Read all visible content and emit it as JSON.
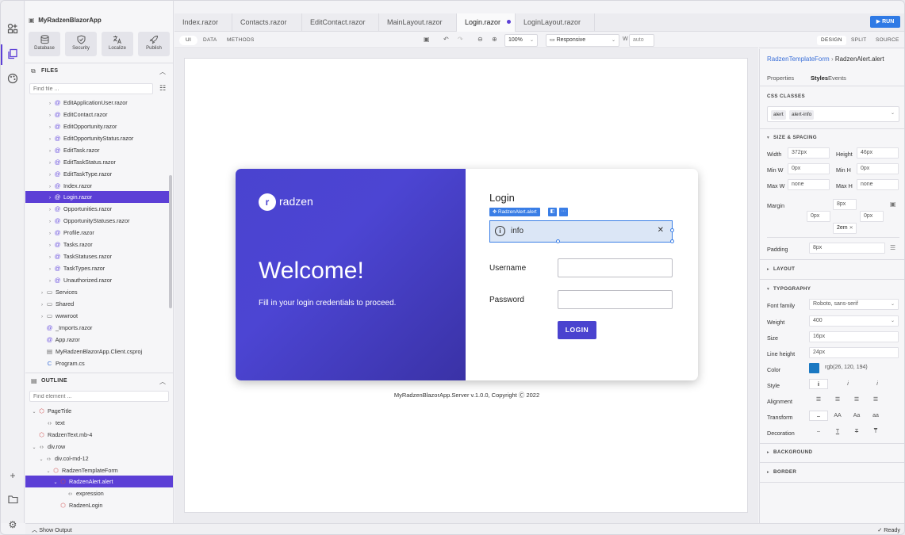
{
  "project": {
    "title": "MyRadzenBlazorApp"
  },
  "tools": [
    {
      "label": "Database",
      "icon": "database-icon"
    },
    {
      "label": "Security",
      "icon": "shield-icon"
    },
    {
      "label": "Localize",
      "icon": "translate-icon"
    },
    {
      "label": "Publish",
      "icon": "rocket-icon"
    }
  ],
  "files": {
    "header": "FILES",
    "search_placeholder": "Find file ...",
    "items": [
      "EditApplicationUser.razor",
      "EditContact.razor",
      "EditOpportunity.razor",
      "EditOpportunityStatus.razor",
      "EditTask.razor",
      "EditTaskStatus.razor",
      "EditTaskType.razor",
      "Index.razor",
      "Login.razor",
      "Opportunities.razor",
      "OpportunityStatuses.razor",
      "Profile.razor",
      "Tasks.razor",
      "TaskStatuses.razor",
      "TaskTypes.razor",
      "Unauthorized.razor"
    ],
    "folders": [
      "Services",
      "Shared",
      "wwwroot"
    ],
    "root_files": [
      "_Imports.razor",
      "App.razor",
      "MyRadzenBlazorApp.Client.csproj",
      "Program.cs"
    ]
  },
  "outline": {
    "header": "OUTLINE",
    "search_placeholder": "Find element ...",
    "items": [
      "PageTitle",
      "text",
      "RadzenText.mb-4",
      "div.row",
      "div.col-md-12",
      "RadzenTemplateForm",
      "RadzenAlert.alert",
      "expression",
      "RadzenLogin"
    ]
  },
  "tabs": [
    "Index.razor",
    "Contacts.razor",
    "EditContact.razor",
    "MainLayout.razor",
    "Login.razor",
    "LoginLayout.razor"
  ],
  "run_label": "RUN",
  "toolbar": {
    "modes": [
      "UI",
      "DATA",
      "METHODS"
    ],
    "zoom": "100%",
    "device": "Responsive",
    "width_label": "W",
    "width_value": "auto"
  },
  "view_modes": [
    "DESIGN",
    "SPLIT",
    "SOURCE"
  ],
  "canvas": {
    "logo_text": "radzen",
    "welcome": "Welcome!",
    "welcome_sub": "Fill in your login credentials to proceed.",
    "login_title": "Login",
    "alert_tag": "RadzenAlert.alert",
    "alert_text": "info",
    "username_label": "Username",
    "password_label": "Password",
    "login_button": "LOGIN",
    "copyright": "MyRadzenBlazorApp.Server v.1.0.0, Copyright Ⓒ 2022"
  },
  "inspector": {
    "breadcrumb_parent": "RadzenTemplateForm",
    "breadcrumb_current": "RadzenAlert.alert",
    "tabs": [
      "Properties",
      "Styles",
      "Events"
    ],
    "css_classes_header": "CSS CLASSES",
    "css_classes": [
      "alert",
      "alert-info"
    ],
    "size_spacing_header": "SIZE & SPACING",
    "width_label": "Width",
    "width_value": "372px",
    "height_label": "Height",
    "height_value": "46px",
    "minw_label": "Min W",
    "minw_value": "0px",
    "minh_label": "Min H",
    "minh_value": "0px",
    "maxw_label": "Max W",
    "maxw_value": "none",
    "maxh_label": "Max H",
    "maxh_value": "none",
    "margin_label": "Margin",
    "margin_top": "8px",
    "margin_left": "0px",
    "margin_right": "0px",
    "margin_bottom": "2em",
    "padding_label": "Padding",
    "padding_value": "8px",
    "layout_header": "LAYOUT",
    "typography_header": "TYPOGRAPHY",
    "font_family_label": "Font family",
    "font_family_value": "Roboto, sans-serif",
    "weight_label": "Weight",
    "weight_value": "400",
    "size_label": "Size",
    "size_value": "16px",
    "line_height_label": "Line height",
    "line_height_value": "24px",
    "color_label": "Color",
    "color_value": "rgb(26, 120, 194)",
    "color_hex": "#1a78c2",
    "style_label": "Style",
    "alignment_label": "Alignment",
    "transform_label": "Transform",
    "transform_options": [
      "AA",
      "Aa",
      "aa"
    ],
    "decoration_label": "Decoration",
    "background_header": "BACKGROUND",
    "border_header": "BORDER"
  },
  "status": {
    "show_output": "Show Output",
    "ready": "Ready"
  },
  "colors": {
    "accent": "#5c3fd6",
    "primary_blue": "#2f7ae5",
    "login_brand": "#4a43cf"
  }
}
